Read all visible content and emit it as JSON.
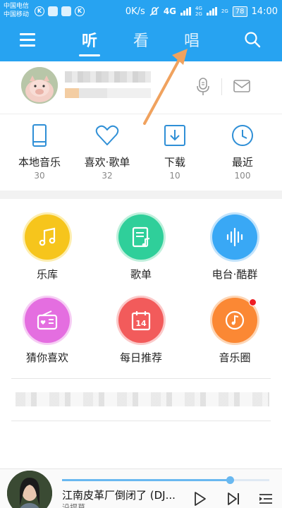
{
  "status_bar": {
    "carrier_1": "中国电信",
    "carrier_2": "中国移动",
    "speed": "0K/s",
    "network": "4G",
    "network_small_1": "4G",
    "network_small_2": "2G",
    "network_alt": "2G",
    "battery": "78",
    "time": "14:00"
  },
  "nav": {
    "tabs": [
      {
        "label": "听",
        "active": true
      },
      {
        "label": "看",
        "active": false
      },
      {
        "label": "唱",
        "active": false
      }
    ]
  },
  "quick_links": [
    {
      "label": "本地音乐",
      "count": "30",
      "icon": "phone-icon"
    },
    {
      "label": "喜欢·歌单",
      "count": "32",
      "icon": "heart-icon"
    },
    {
      "label": "下载",
      "count": "10",
      "icon": "download-icon"
    },
    {
      "label": "最近",
      "count": "100",
      "icon": "clock-icon"
    }
  ],
  "grid": [
    {
      "label": "乐库",
      "color": "#f6c51c",
      "icon": "music-note-icon"
    },
    {
      "label": "歌单",
      "color": "#2fcf9a",
      "icon": "playlist-icon"
    },
    {
      "label": "电台·酷群",
      "color": "#39a8f5",
      "icon": "soundwave-icon"
    },
    {
      "label": "猜你喜欢",
      "color": "#e46ee0",
      "icon": "radio-icon"
    },
    {
      "label": "每日推荐",
      "color": "#f25b5b",
      "icon": "calendar-icon",
      "badge": "14"
    },
    {
      "label": "音乐圈",
      "color": "#fb8834",
      "icon": "disc-icon"
    }
  ],
  "colors": {
    "brand": "#27a3f1",
    "annotation_arrow": "#f0a25e"
  },
  "player": {
    "title": "江南皮革厂倒闭了 (DJ...",
    "artist": "沿提莫",
    "progress": 0.81
  }
}
